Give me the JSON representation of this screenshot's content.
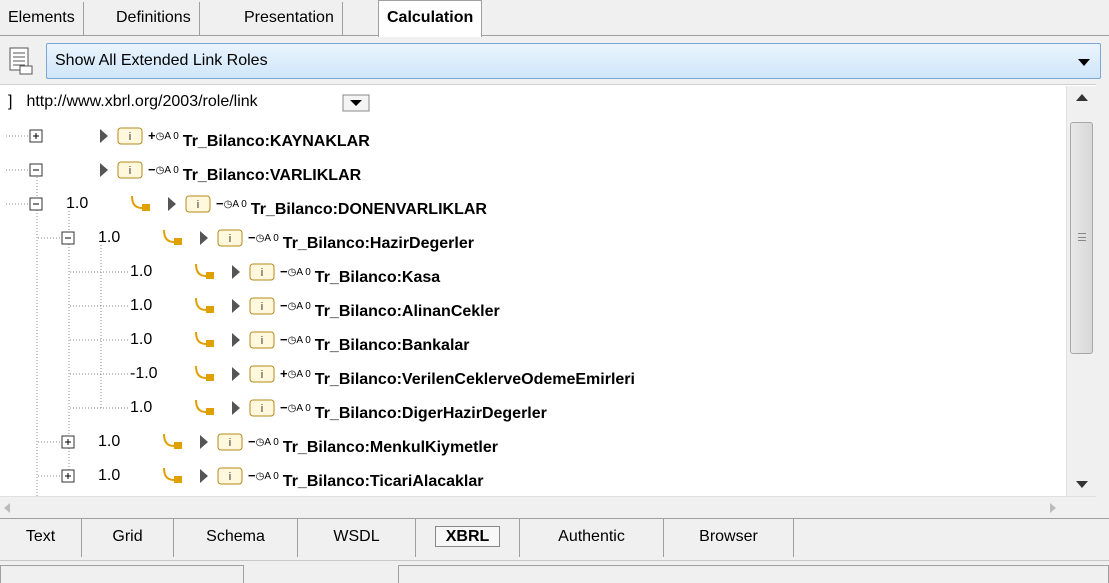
{
  "top_tabs": [
    "Elements",
    "Definitions",
    "Presentation",
    "Calculation"
  ],
  "active_top_tab": "Calculation",
  "role_selector": {
    "selected": "Show All Extended Link Roles"
  },
  "tree": {
    "link_role": "http://www.xbrl.org/2003/role/link",
    "flag_text": "A 0",
    "rows": [
      {
        "weight": "",
        "sign": "+",
        "concept": "Tr_Bilanco:KAYNAKLAR"
      },
      {
        "weight": "",
        "sign": "−",
        "concept": "Tr_Bilanco:VARLIKLAR"
      },
      {
        "weight": "1.0",
        "sign": "−",
        "concept": "Tr_Bilanco:DONENVARLIKLAR"
      },
      {
        "weight": "1.0",
        "sign": "−",
        "concept": "Tr_Bilanco:HazirDegerler"
      },
      {
        "weight": "1.0",
        "sign": "−",
        "concept": "Tr_Bilanco:Kasa"
      },
      {
        "weight": "1.0",
        "sign": "−",
        "concept": "Tr_Bilanco:AlinanCekler"
      },
      {
        "weight": "1.0",
        "sign": "−",
        "concept": "Tr_Bilanco:Bankalar"
      },
      {
        "weight": "-1.0",
        "sign": "+",
        "concept": "Tr_Bilanco:VerilenCeklerveOdemeEmirleri"
      },
      {
        "weight": "1.0",
        "sign": "−",
        "concept": "Tr_Bilanco:DigerHazirDegerler"
      },
      {
        "weight": "1.0",
        "sign": "−",
        "concept": "Tr_Bilanco:MenkulKiymetler"
      },
      {
        "weight": "1.0",
        "sign": "−",
        "concept": "Tr_Bilanco:TicariAlacaklar"
      }
    ]
  },
  "bottom_tabs": [
    "Text",
    "Grid",
    "Schema",
    "WSDL",
    "XBRL",
    "Authentic",
    "Browser"
  ],
  "active_bottom_tab": "XBRL",
  "colors": {
    "accent": "#7aa7d6",
    "item_icon": "#b58a1b",
    "arc_icon": "#e0a000"
  }
}
